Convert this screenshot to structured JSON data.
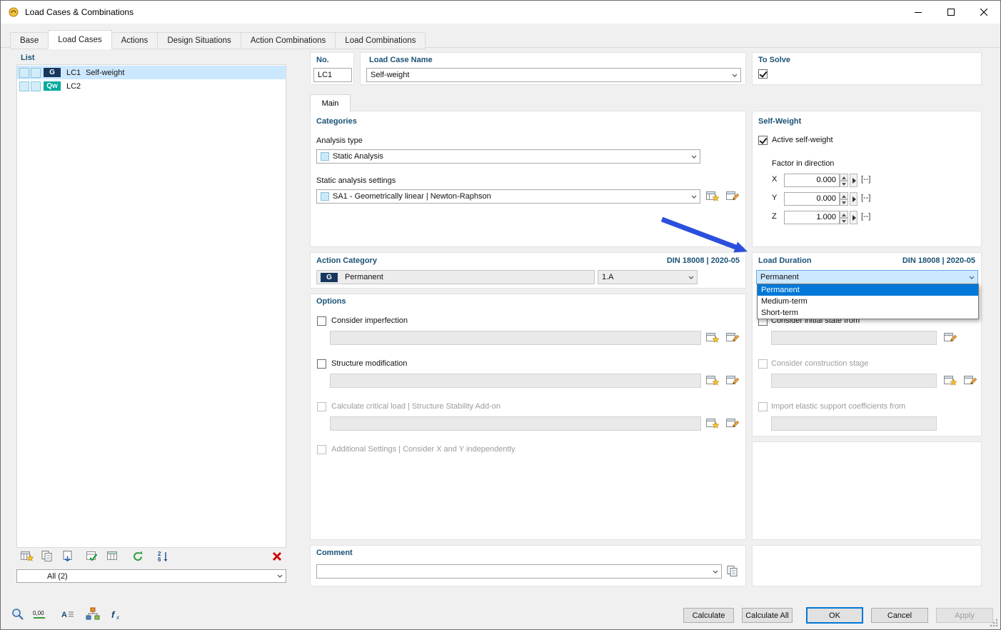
{
  "window": {
    "title": "Load Cases & Combinations"
  },
  "tabs": [
    {
      "label": "Base"
    },
    {
      "label": "Load Cases"
    },
    {
      "label": "Actions"
    },
    {
      "label": "Design Situations"
    },
    {
      "label": "Action Combinations"
    },
    {
      "label": "Load Combinations"
    }
  ],
  "list_panel": {
    "header": "List",
    "rows": [
      {
        "badge": "G",
        "id": "LC1",
        "name": "Self-weight"
      },
      {
        "badge": "Qw",
        "id": "LC2",
        "name": ""
      }
    ],
    "filter_value": "All (2)"
  },
  "header_fields": {
    "no_label": "No.",
    "no_value": "LC1",
    "name_label": "Load Case Name",
    "name_value": "Self-weight",
    "to_solve_label": "To Solve"
  },
  "main_tab": {
    "label": "Main"
  },
  "categories": {
    "header": "Categories",
    "analysis_type_label": "Analysis type",
    "analysis_type_value": "Static Analysis",
    "settings_label": "Static analysis settings",
    "settings_value": "SA1 - Geometrically linear | Newton-Raphson"
  },
  "action_category": {
    "header": "Action Category",
    "standard": "DIN 18008 | 2020-05",
    "badge": "G",
    "category_value": "Permanent",
    "group_value": "1.A"
  },
  "options": {
    "header": "Options",
    "imperfection_label": "Consider imperfection",
    "structure_label": "Structure modification",
    "critical_label": "Calculate critical load | Structure Stability Add-on",
    "additional_label": "Additional Settings | Consider X and Y independently"
  },
  "comment": {
    "header": "Comment",
    "value": ""
  },
  "self_weight": {
    "header": "Self-Weight",
    "active_label": "Active self-weight",
    "factor_label": "Factor in direction",
    "rows": [
      {
        "axis": "X",
        "value": "0.000",
        "unit": "[--]"
      },
      {
        "axis": "Y",
        "value": "0.000",
        "unit": "[--]"
      },
      {
        "axis": "Z",
        "value": "1.000",
        "unit": "[--]"
      }
    ]
  },
  "load_duration": {
    "header": "Load Duration",
    "standard": "DIN 18008 | 2020-05",
    "value": "Permanent",
    "options": [
      {
        "label": "Permanent"
      },
      {
        "label": "Medium-term"
      },
      {
        "label": "Short-term"
      }
    ]
  },
  "initial_state": {
    "row1_label": "Consider initial state from",
    "row2_label": "Consider construction stage",
    "row3_label": "Import elastic support coefficients from"
  },
  "footer": {
    "calculate": "Calculate",
    "calculate_all": "Calculate All",
    "ok": "OK",
    "cancel": "Cancel",
    "apply": "Apply"
  },
  "colors": {
    "accent": "#0078d7",
    "section_header": "#1a5276",
    "badge_g": "#17365d",
    "badge_qw": "#00a99d",
    "selection": "#cce8ff",
    "annotation_arrow": "#2b4fdd"
  }
}
